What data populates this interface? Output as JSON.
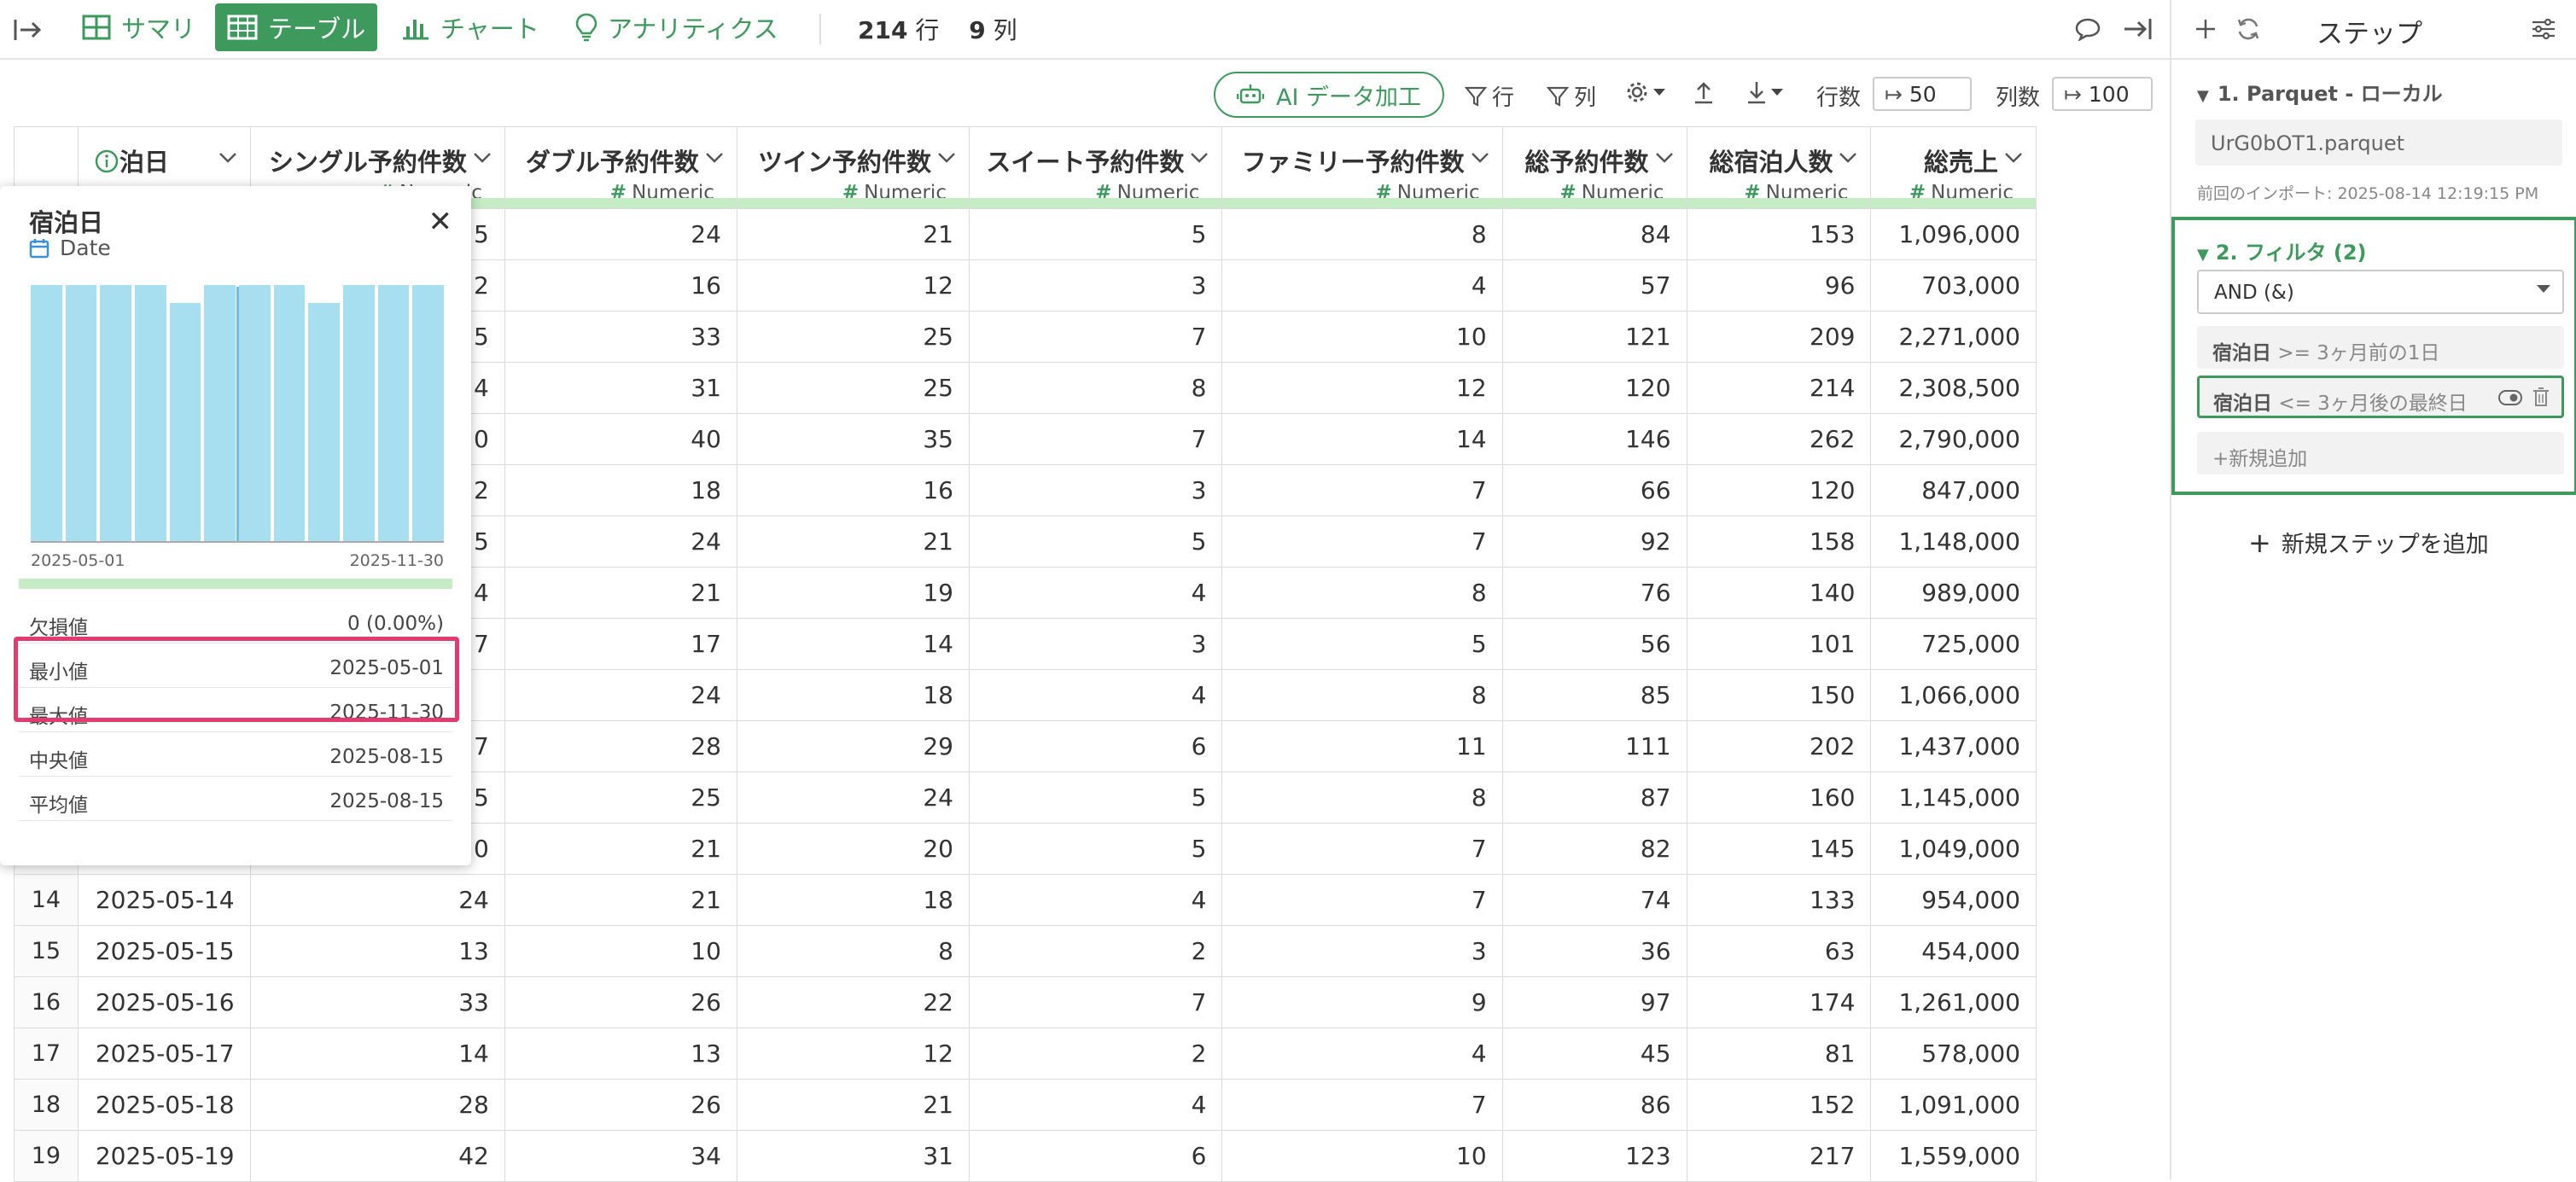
{
  "topbar": {
    "tabs": [
      {
        "label": "サマリ",
        "icon": "summary-grid-icon"
      },
      {
        "label": "テーブル",
        "icon": "table-icon"
      },
      {
        "label": "チャート",
        "icon": "bar-chart-icon"
      },
      {
        "label": "アナリティクス",
        "icon": "lightbulb-icon"
      }
    ],
    "rows_count": "214",
    "rows_unit": "行",
    "cols_count": "9",
    "cols_unit": "列",
    "accent_color": "#3d9a5c"
  },
  "toolbar": {
    "ai_button": "AI データ加工",
    "row_filter": "行",
    "col_filter": "列",
    "rows_label": "行数",
    "rows_value": "50",
    "cols_label": "列数",
    "cols_value": "100"
  },
  "table": {
    "columns": [
      {
        "name": "泊日",
        "type": ""
      },
      {
        "name": "シングル予約件数",
        "type": "Numeric"
      },
      {
        "name": "ダブル予約件数",
        "type": "Numeric"
      },
      {
        "name": "ツイン予約件数",
        "type": "Numeric"
      },
      {
        "name": "スイート予約件数",
        "type": "Numeric"
      },
      {
        "name": "ファミリー予約件数",
        "type": "Numeric"
      },
      {
        "name": "総予約件数",
        "type": "Numeric"
      },
      {
        "name": "総宿泊人数",
        "type": "Numeric"
      },
      {
        "name": "総売上",
        "type": "Numeric"
      }
    ],
    "rows": [
      [
        "",
        "",
        "",
        "24",
        "21",
        "5",
        "8",
        "84",
        "153",
        "1,096,000"
      ],
      [
        "",
        "",
        "",
        "16",
        "12",
        "3",
        "4",
        "57",
        "96",
        "703,000"
      ],
      [
        "",
        "",
        "",
        "33",
        "25",
        "7",
        "10",
        "121",
        "209",
        "2,271,000"
      ],
      [
        "",
        "",
        "",
        "31",
        "25",
        "8",
        "12",
        "120",
        "214",
        "2,308,500"
      ],
      [
        "",
        "",
        "",
        "40",
        "35",
        "7",
        "14",
        "146",
        "262",
        "2,790,000"
      ],
      [
        "",
        "",
        "",
        "18",
        "16",
        "3",
        "7",
        "66",
        "120",
        "847,000"
      ],
      [
        "",
        "",
        "",
        "24",
        "21",
        "5",
        "7",
        "92",
        "158",
        "1,148,000"
      ],
      [
        "",
        "",
        "",
        "21",
        "19",
        "4",
        "8",
        "76",
        "140",
        "989,000"
      ],
      [
        "",
        "",
        "",
        "17",
        "14",
        "3",
        "5",
        "56",
        "101",
        "725,000"
      ],
      [
        "",
        "",
        "",
        "24",
        "18",
        "4",
        "8",
        "85",
        "150",
        "1,066,000"
      ],
      [
        "",
        "",
        "",
        "28",
        "29",
        "6",
        "11",
        "111",
        "202",
        "1,437,000"
      ],
      [
        "",
        "",
        "",
        "25",
        "24",
        "5",
        "8",
        "87",
        "160",
        "1,145,000"
      ],
      [
        "",
        "",
        "",
        "21",
        "20",
        "5",
        "7",
        "82",
        "145",
        "1,049,000"
      ],
      [
        "14",
        "2025-05-14",
        "24",
        "21",
        "18",
        "4",
        "7",
        "74",
        "133",
        "954,000"
      ],
      [
        "15",
        "2025-05-15",
        "13",
        "10",
        "8",
        "2",
        "3",
        "36",
        "63",
        "454,000"
      ],
      [
        "16",
        "2025-05-16",
        "33",
        "26",
        "22",
        "7",
        "9",
        "97",
        "174",
        "1,261,000"
      ],
      [
        "17",
        "2025-05-17",
        "14",
        "13",
        "12",
        "2",
        "4",
        "45",
        "81",
        "578,000"
      ],
      [
        "18",
        "2025-05-18",
        "28",
        "26",
        "21",
        "4",
        "7",
        "86",
        "152",
        "1,091,000"
      ],
      [
        "19",
        "2025-05-19",
        "42",
        "34",
        "31",
        "6",
        "10",
        "123",
        "217",
        "1,559,000"
      ]
    ],
    "partial_last_digits": [
      "5",
      "2",
      "5",
      "4",
      "0",
      "2",
      "5",
      "4",
      "7",
      "",
      "7",
      "5",
      "0"
    ]
  },
  "popup": {
    "title": "宿泊日",
    "type": "Date",
    "hist_min_label": "2025-05-01",
    "hist_max_label": "2025-11-30",
    "hist_bins": [
      1.0,
      1.0,
      1.0,
      1.0,
      0.93,
      1.0,
      1.0,
      1.0,
      0.93,
      1.0,
      1.0,
      1.0
    ],
    "median_fraction": 0.5,
    "stats": [
      {
        "label": "欠損値",
        "value": "0 (0.00%)"
      },
      {
        "label": "最小値",
        "value": "2025-05-01"
      },
      {
        "label": "最大値",
        "value": "2025-11-30"
      },
      {
        "label": "中央値",
        "value": "2025-08-15"
      },
      {
        "label": "平均値",
        "value": "2025-08-15"
      }
    ],
    "highlight_color": "#e23b6e"
  },
  "steps": {
    "header_title": "ステップ",
    "step1_title": "1. Parquet - ローカル",
    "step1_file": "UrG0bOT1.parquet",
    "step1_note": "前回のインポート: 2025-08-14 12:19:15 PM",
    "step2_title": "2. フィルタ (2)",
    "and_label": "AND (&)",
    "cond1_col": "宿泊日",
    "cond1_rest": ">= 3ヶ月前の1日",
    "cond2_col": "宿泊日",
    "cond2_rest": "<= 3ヶ月後の最終日",
    "add_condition": "新規追加",
    "add_step": "新規ステップを追加"
  }
}
